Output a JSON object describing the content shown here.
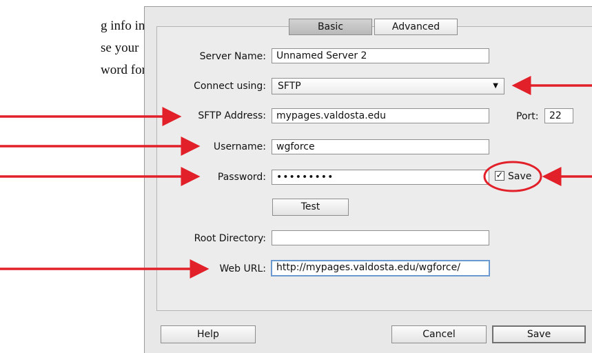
{
  "instructions": {
    "lines": [
      "g info in the",
      "se your",
      "word for active"
    ]
  },
  "tabs": {
    "basic": "Basic",
    "advanced": "Advanced"
  },
  "form": {
    "server_name_label": "Server Name:",
    "server_name_value": "Unnamed Server 2",
    "connect_label": "Connect using:",
    "connect_value": "SFTP",
    "address_label": "SFTP Address:",
    "address_value": "mypages.valdosta.edu",
    "port_label": "Port:",
    "port_value": "22",
    "username_label": "Username:",
    "username_value": "wgforce",
    "password_label": "Password:",
    "password_value": "•••••••••",
    "save_checkbox_label": "Save",
    "save_checked": true,
    "test_button": "Test",
    "root_label": "Root Directory:",
    "root_value": "",
    "weburl_label": "Web URL:",
    "weburl_value": "http://mypages.valdosta.edu/wgforce/"
  },
  "buttons": {
    "help": "Help",
    "cancel": "Cancel",
    "save": "Save"
  },
  "colors": {
    "annotation_red": "#e2202a",
    "dialog_bg": "#e8e8e8",
    "focus_border": "#6a98d0"
  }
}
